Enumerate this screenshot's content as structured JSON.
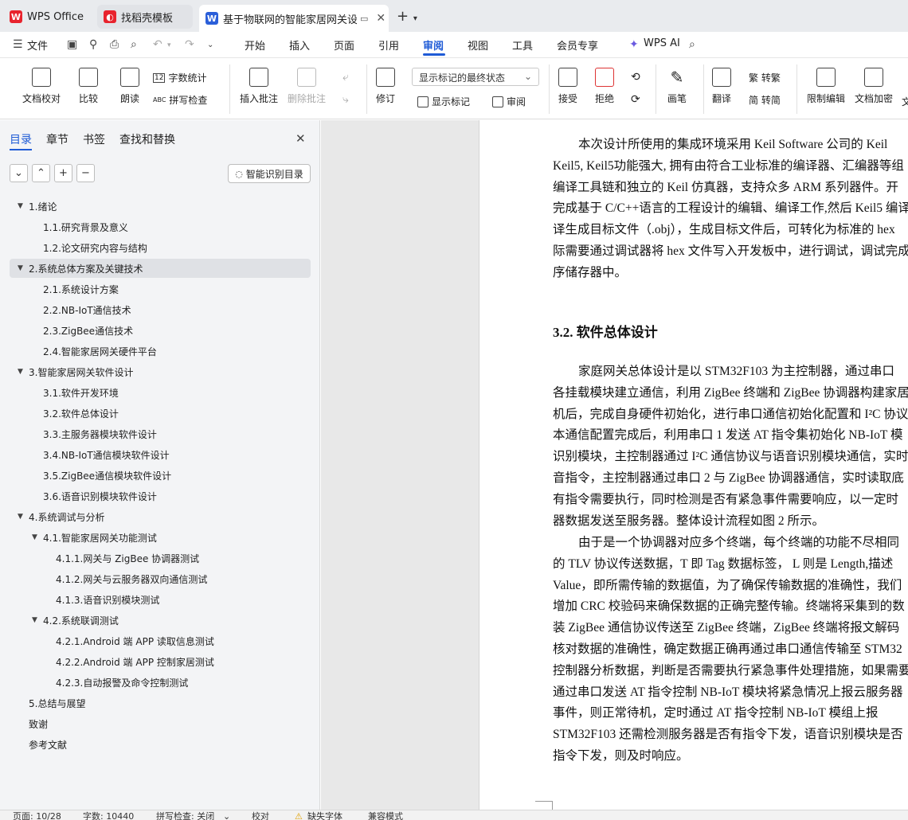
{
  "tabs": [
    {
      "label": "WPS Office",
      "icon": "wps-logo-icon",
      "color": "#e8232d"
    },
    {
      "label": "找稻壳模板",
      "icon": "docer-logo-icon",
      "color": "#e8232d"
    },
    {
      "label": "基于物联网的智能家居网关设计",
      "icon": "wps-writer-icon",
      "color": "#2b5fd9"
    }
  ],
  "menubar": {
    "file": "文件",
    "items": [
      "开始",
      "插入",
      "页面",
      "引用",
      "审阅",
      "视图",
      "工具",
      "会员专享"
    ],
    "active": "审阅",
    "ai": "WPS AI"
  },
  "ribbon": {
    "doc_proof": "文档校对",
    "compare": "比较",
    "read_aloud": "朗读",
    "word_count_icon": "12",
    "word_count": "字数统计",
    "spell_icon": "ABC",
    "spell_check": "拼写检查",
    "insert_comment": "插入批注",
    "delete_comment": "删除批注",
    "revise": "修订",
    "markup_state": "显示标记的最终状态",
    "show_markup": "显示标记",
    "review_pane": "审阅",
    "accept": "接受",
    "reject": "拒绝",
    "pen": "画笔",
    "translate": "翻译",
    "to_trad": "繁 转繁",
    "to_simp": "简 转简",
    "restrict_edit": "限制编辑",
    "doc_encrypt": "文档加密",
    "doc_more": "文"
  },
  "nav": {
    "tabs": [
      "目录",
      "章节",
      "书签",
      "查找和替换"
    ],
    "smart_toc": "智能识别目录",
    "toc": [
      {
        "label": "1.绪论",
        "level": 1,
        "expanded": true
      },
      {
        "label": "1.1.研究背景及意义",
        "level": 2
      },
      {
        "label": "1.2.论文研究内容与结构",
        "level": 2
      },
      {
        "label": "2.系统总体方案及关键技术",
        "level": 1,
        "expanded": true,
        "selected": true
      },
      {
        "label": "2.1.系统设计方案",
        "level": 2
      },
      {
        "label": "2.2.NB-IoT通信技术",
        "level": 2
      },
      {
        "label": "2.3.ZigBee通信技术",
        "level": 2
      },
      {
        "label": "2.4.智能家居网关硬件平台",
        "level": 2
      },
      {
        "label": "3.智能家居网关软件设计",
        "level": 1,
        "expanded": true
      },
      {
        "label": "3.1.软件开发环境",
        "level": 2
      },
      {
        "label": "3.2.软件总体设计",
        "level": 2
      },
      {
        "label": "3.3.主服务器模块软件设计",
        "level": 2
      },
      {
        "label": "3.4.NB-IoT通信模块软件设计",
        "level": 2
      },
      {
        "label": "3.5.ZigBee通信模块软件设计",
        "level": 2
      },
      {
        "label": "3.6.语音识别模块软件设计",
        "level": 2
      },
      {
        "label": "4.系统调试与分析",
        "level": 1,
        "expanded": true
      },
      {
        "label": "4.1.智能家居网关功能测试",
        "level": 2,
        "expanded": true
      },
      {
        "label": "4.1.1.网关与 ZigBee 协调器测试",
        "level": 3
      },
      {
        "label": "4.1.2.网关与云服务器双向通信测试",
        "level": 3
      },
      {
        "label": "4.1.3.语音识别模块测试",
        "level": 3
      },
      {
        "label": "4.2.系统联调测试",
        "level": 2,
        "expanded": true
      },
      {
        "label": "4.2.1.Android 端 APP 读取信息测试",
        "level": 3
      },
      {
        "label": "4.2.2.Android 端 APP 控制家居测试",
        "level": 3
      },
      {
        "label": "4.2.3.自动报警及命令控制测试",
        "level": 3
      },
      {
        "label": "5.总结与展望",
        "level": 1
      },
      {
        "label": "致谢",
        "level": 1
      },
      {
        "label": "参考文献",
        "level": 1
      }
    ]
  },
  "document": {
    "para1": [
      "本次设计所使用的集成环境采用 Keil Software 公司的 Keil",
      "Keil5, Keil5功能强大, 拥有由符合工业标准的编译器、汇编器等组",
      "编译工具链和独立的 Keil 仿真器，支持众多 ARM 系列器件。开",
      "完成基于 C/C++语言的工程设计的编辑、编译工作,然后 Keil5 编译",
      "译生成目标文件（.obj），生成目标文件后，可转化为标准的 hex",
      "际需要通过调试器将 hex 文件写入开发板中，进行调试，调试完成",
      "序储存器中。"
    ],
    "heading": "3.2.  软件总体设计",
    "para2": [
      "家庭网关总体设计是以 STM32F103 为主控制器，通过串口",
      "各挂载模块建立通信，利用 ZigBee 终端和 ZigBee 协调器构建家居",
      "机后，完成自身硬件初始化，进行串口通信初始化配置和 I²C 协议",
      "本通信配置完成后，利用串口 1 发送 AT 指令集初始化 NB-IoT 模",
      "识别模块，主控制器通过 I²C 通信协议与语音识别模块通信，实时",
      "音指令，主控制器通过串口 2 与 ZigBee 协调器通信，实时读取底",
      "有指令需要执行，同时检测是否有紧急事件需要响应，以一定时",
      "器数据发送至服务器。整体设计流程如图 2 所示。"
    ],
    "para3": [
      "由于是一个协调器对应多个终端，每个终端的功能不尽相同",
      "的 TLV 协议传送数据，T 即 Tag  数据标签，  L 则是 Length,描述",
      "Value，即所需传输的数据值，为了确保传输数据的准确性，我们",
      "增加 CRC 校验码来确保数据的正确完整传输。终端将采集到的数",
      "装 ZigBee 通信协议传送至 ZigBee 终端，ZigBee 终端将报文解码",
      "核对数据的准确性，确定数据正确再通过串口通信传输至 STM32",
      "控制器分析数据，判断是否需要执行紧急事件处理措施，如果需要",
      "通过串口发送 AT 指令控制 NB-IoT 模块将紧急情况上报云服务器",
      "事件，则正常待机，定时通过 AT 指令控制 NB-IoT 模组上报",
      "STM32F103 还需检测服务器是否有指令下发，语音识别模块是否",
      "指令下发，则及时响应。"
    ]
  },
  "status": {
    "page": "页面: 10/28",
    "words": "字数: 10440",
    "spell": "拼写检查: 关闭",
    "proof": "校对",
    "missing_font": "缺失字体",
    "compat": "兼容模式"
  }
}
